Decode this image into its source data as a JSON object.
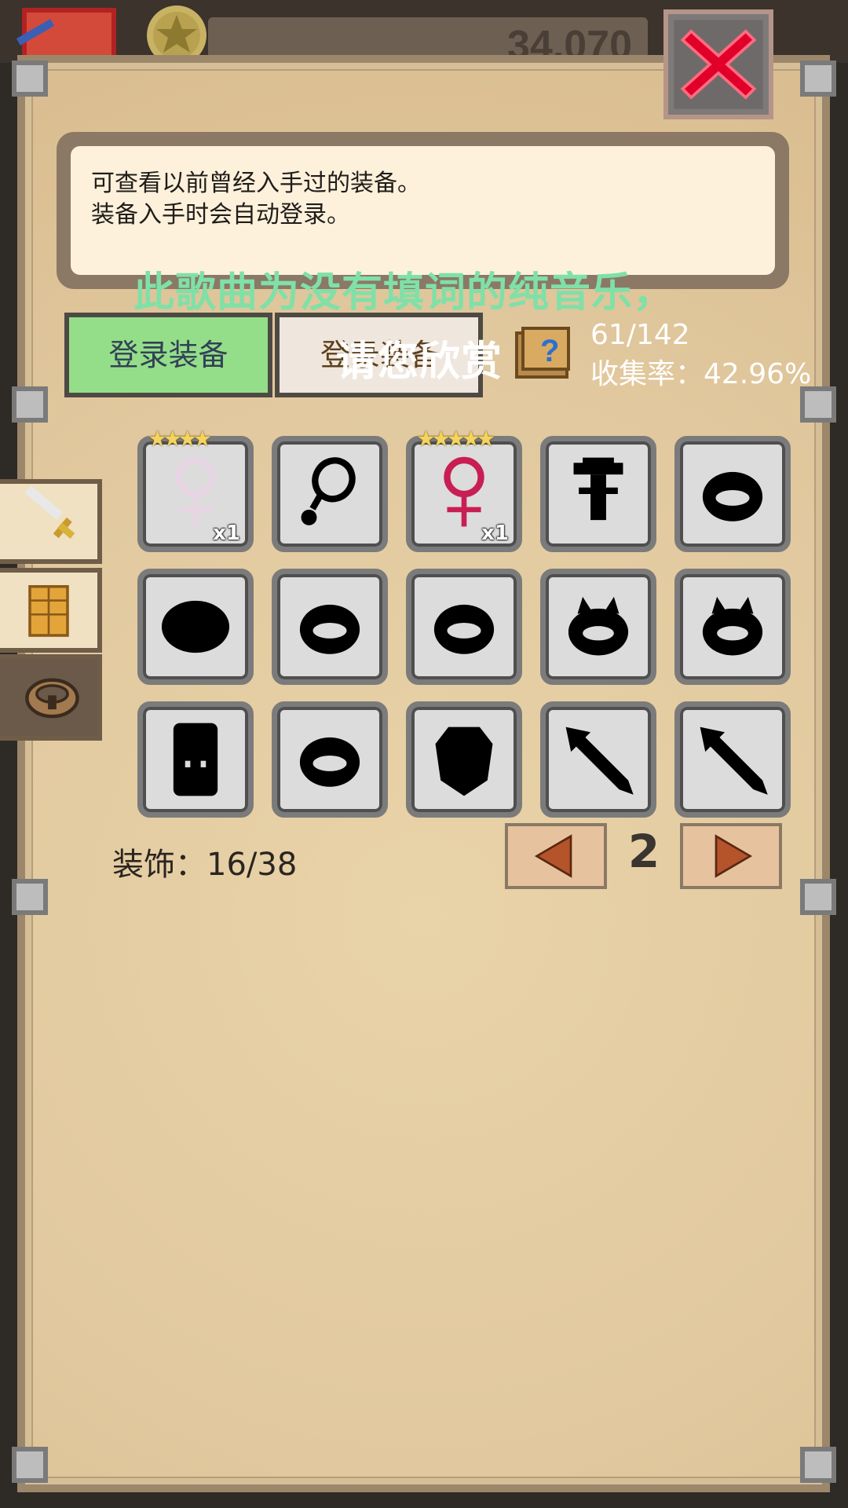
{
  "top_bar": {
    "gold": "34,070"
  },
  "info": {
    "line1": "可查看以前曾经入手过的装备。",
    "line2": "装备入手时会自动登录。"
  },
  "overlay_subtitles": {
    "line1": "此歌曲为没有填词的纯音乐，",
    "line2": "请您欣赏"
  },
  "tabs": {
    "registered": "登录装备",
    "other": "登录装备"
  },
  "collection": {
    "count": "61/142",
    "rate": "收集率：42.96%"
  },
  "side_tabs": [
    {
      "icon": "sword-icon"
    },
    {
      "icon": "armor-icon"
    },
    {
      "icon": "accessory-icon"
    }
  ],
  "grid": {
    "items": [
      {
        "icon": "ring-amulet-icon",
        "stars": "★★★★",
        "qty": "x1",
        "color": "#e7d5e4"
      },
      {
        "icon": "pendant-silhouette-icon"
      },
      {
        "icon": "ring-amulet-icon",
        "stars": "★★★★★",
        "qty": "x1",
        "color": "#c81e54"
      },
      {
        "icon": "brooch-silhouette-icon"
      },
      {
        "icon": "ring-silhouette-icon"
      },
      {
        "icon": "oval-silhouette-icon"
      },
      {
        "icon": "ring-silhouette-icon"
      },
      {
        "icon": "ring-silhouette-icon"
      },
      {
        "icon": "cat-ring-silhouette-icon"
      },
      {
        "icon": "cat-ring-silhouette-icon"
      },
      {
        "icon": "scroll-silhouette-icon"
      },
      {
        "icon": "ring-silhouette-icon"
      },
      {
        "icon": "gem-silhouette-icon"
      },
      {
        "icon": "arrow-silhouette-icon"
      },
      {
        "icon": "arrow-silhouette-icon"
      }
    ]
  },
  "footer": {
    "count": "装饰：16/38",
    "page": "2"
  },
  "colors": {
    "panel": "#e2c99f",
    "tab_active": "#94de8a",
    "close_red": "#e0002a"
  }
}
